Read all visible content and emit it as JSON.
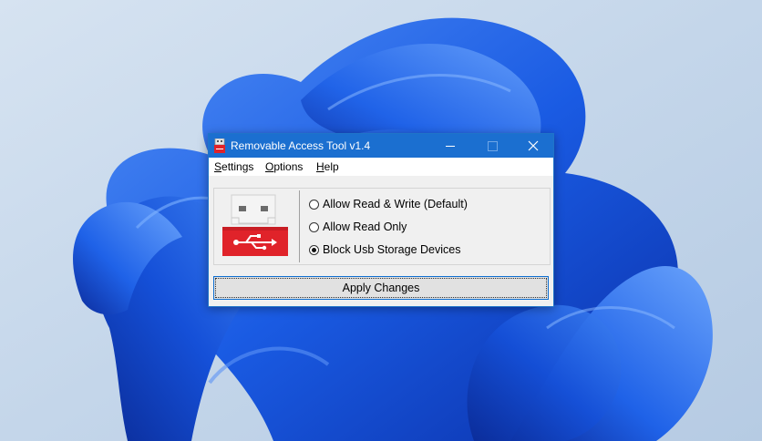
{
  "window": {
    "title": "Removable Access Tool v1.4"
  },
  "menu": {
    "settings": {
      "mnemonic": "S",
      "rest": "ettings"
    },
    "options": {
      "mnemonic": "O",
      "rest": "ptions"
    },
    "help": {
      "mnemonic": "H",
      "rest": "elp"
    }
  },
  "access_options": [
    {
      "label": "Allow Read & Write (Default)",
      "selected": false
    },
    {
      "label": "Allow Read Only",
      "selected": false
    },
    {
      "label": "Block Usb Storage Devices",
      "selected": true
    }
  ],
  "apply_label": "Apply Changes",
  "colors": {
    "titlebar": "#1b6fd0",
    "usb_red": "#e0232a",
    "wallpaper_bg": "#c9d9ec",
    "wallpaper_blue": "#1b5fe0"
  },
  "icons": {
    "app": "usb-drive-icon",
    "logo": "usb-stick-red-logo"
  }
}
